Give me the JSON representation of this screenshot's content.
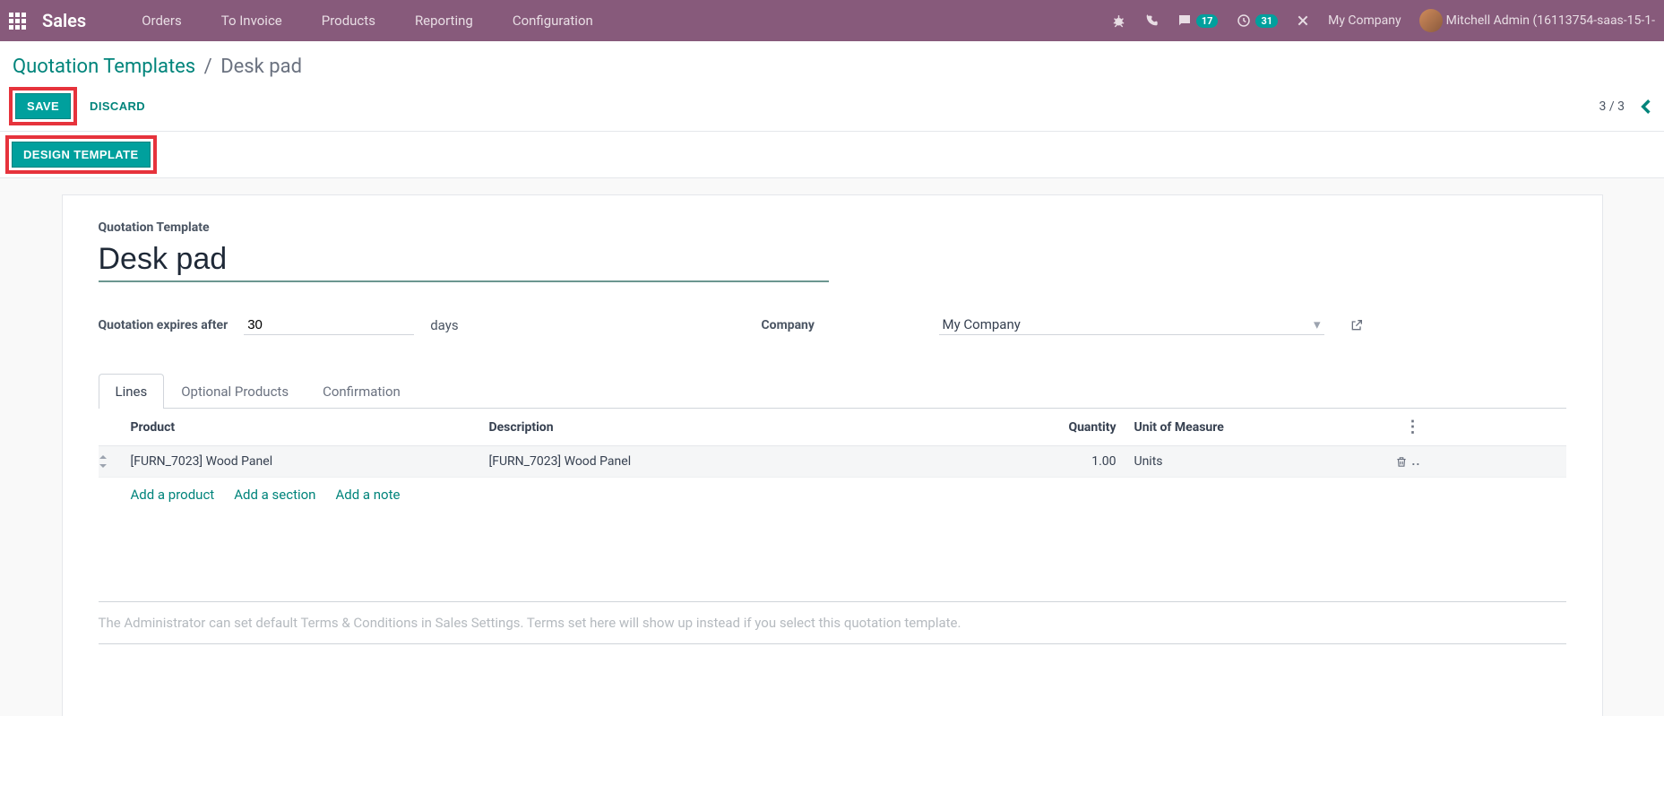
{
  "topbar": {
    "brand": "Sales",
    "nav": [
      "Orders",
      "To Invoice",
      "Products",
      "Reporting",
      "Configuration"
    ],
    "badge_msg": "17",
    "badge_clock": "31",
    "company": "My Company",
    "user": "Mitchell Admin (16113754-saas-15-1-"
  },
  "breadcrumbs": {
    "parent": "Quotation Templates",
    "sep": "/",
    "current": "Desk pad"
  },
  "actions": {
    "save": "SAVE",
    "discard": "DISCARD",
    "design": "DESIGN TEMPLATE"
  },
  "pager": {
    "text": "3 / 3"
  },
  "form": {
    "title_label": "Quotation Template",
    "title_value": "Desk pad",
    "expires_label": "Quotation expires after",
    "expires_value": "30",
    "days_label": "days",
    "company_label": "Company",
    "company_value": "My Company"
  },
  "tabs": [
    "Lines",
    "Optional Products",
    "Confirmation"
  ],
  "table": {
    "headers": {
      "product": "Product",
      "description": "Description",
      "qty": "Quantity",
      "uom": "Unit of Measure"
    },
    "rows": [
      {
        "product": "[FURN_7023] Wood Panel",
        "description": "[FURN_7023] Wood Panel",
        "qty": "1.00",
        "uom": "Units"
      }
    ],
    "adders": {
      "product": "Add a product",
      "section": "Add a section",
      "note": "Add a note"
    }
  },
  "terms_hint": "The Administrator can set default Terms & Conditions in Sales Settings. Terms set here will show up instead if you select this quotation template."
}
